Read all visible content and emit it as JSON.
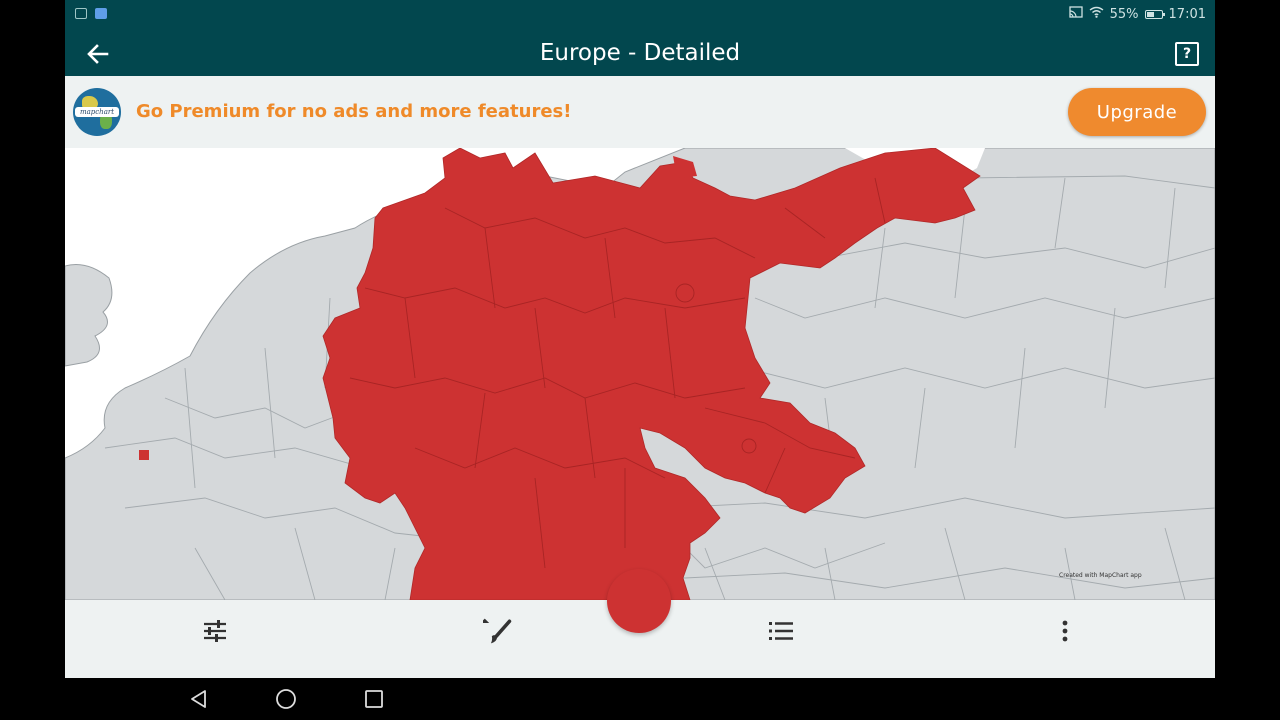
{
  "status": {
    "battery_pct": "55%",
    "time": "17:01",
    "battery_level": 0.55
  },
  "toolbar": {
    "title": "Europe - Detailed",
    "help_icon": "?"
  },
  "promo": {
    "logo_text": "mapchart",
    "message": "Go Premium for no ads and more features!",
    "upgrade_label": "Upgrade"
  },
  "map": {
    "watermark": "Created with MapChart app",
    "fill_color": "#cd3232",
    "land_color": "#d5d8da",
    "sea_color": "#ffffff"
  },
  "icons": {
    "back": "arrow-left-icon",
    "help": "question-box-icon",
    "settings": "sliders-icon",
    "paint": "paint-brush-icon",
    "list": "list-icon",
    "more": "more-vertical-icon",
    "fab": "color-fab"
  },
  "colors": {
    "header_bg": "#02474e",
    "accent_orange": "#ef8a2e",
    "map_red": "#cd3232"
  }
}
